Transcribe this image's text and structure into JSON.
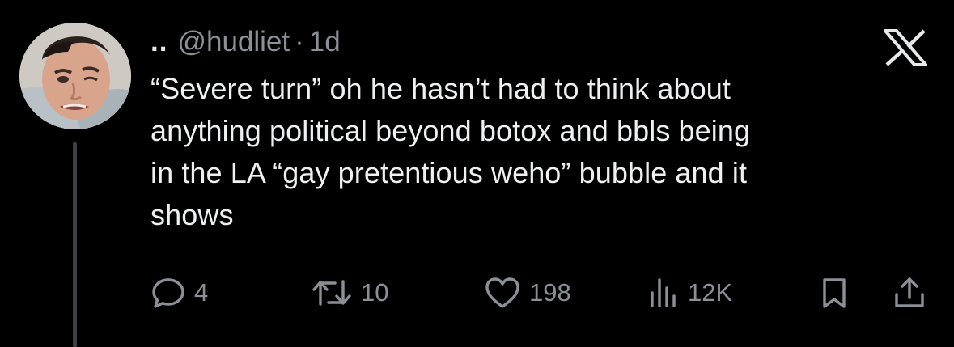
{
  "tweet": {
    "display_name": "..",
    "handle": "@hudliet",
    "separator": "·",
    "time": "1d",
    "text": "“Severe turn” oh he hasn’t had to think about\nanything political beyond botox and bbls being\nin the LA “gay pretentious weho” bubble and it\nshows"
  },
  "actions": {
    "reply_count": "4",
    "repost_count": "10",
    "like_count": "198",
    "view_count": "12K"
  },
  "icons": {
    "logo": "x-logo-icon",
    "reply": "reply-icon",
    "repost": "repost-icon",
    "like": "heart-icon",
    "views": "views-icon",
    "bookmark": "bookmark-icon",
    "share": "share-icon"
  },
  "colors": {
    "background": "#000000",
    "text": "#e7e9ea",
    "muted": "#8b9096",
    "thread_line": "#3e4144"
  }
}
